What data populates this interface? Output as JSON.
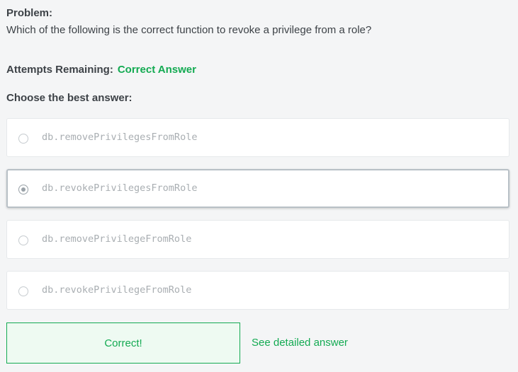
{
  "problem": {
    "label": "Problem:",
    "question": "Which of the following is the correct function to revoke a privilege from a role?"
  },
  "attempts": {
    "label": "Attempts Remaining:",
    "status": "Correct Answer"
  },
  "choose_label": "Choose the best answer:",
  "options": [
    {
      "label": "db.removePrivilegesFromRole",
      "selected": false
    },
    {
      "label": "db.revokePrivilegesFromRole",
      "selected": true
    },
    {
      "label": "db.removePrivilegeFromRole",
      "selected": false
    },
    {
      "label": "db.revokePrivilegeFromRole",
      "selected": false
    }
  ],
  "result": {
    "message": "Correct!",
    "detail_link": "See detailed answer"
  },
  "colors": {
    "accent_green": "#13aa52",
    "background": "#f4f5f6",
    "text": "#3d4247",
    "option_text": "#a9aeb2"
  }
}
